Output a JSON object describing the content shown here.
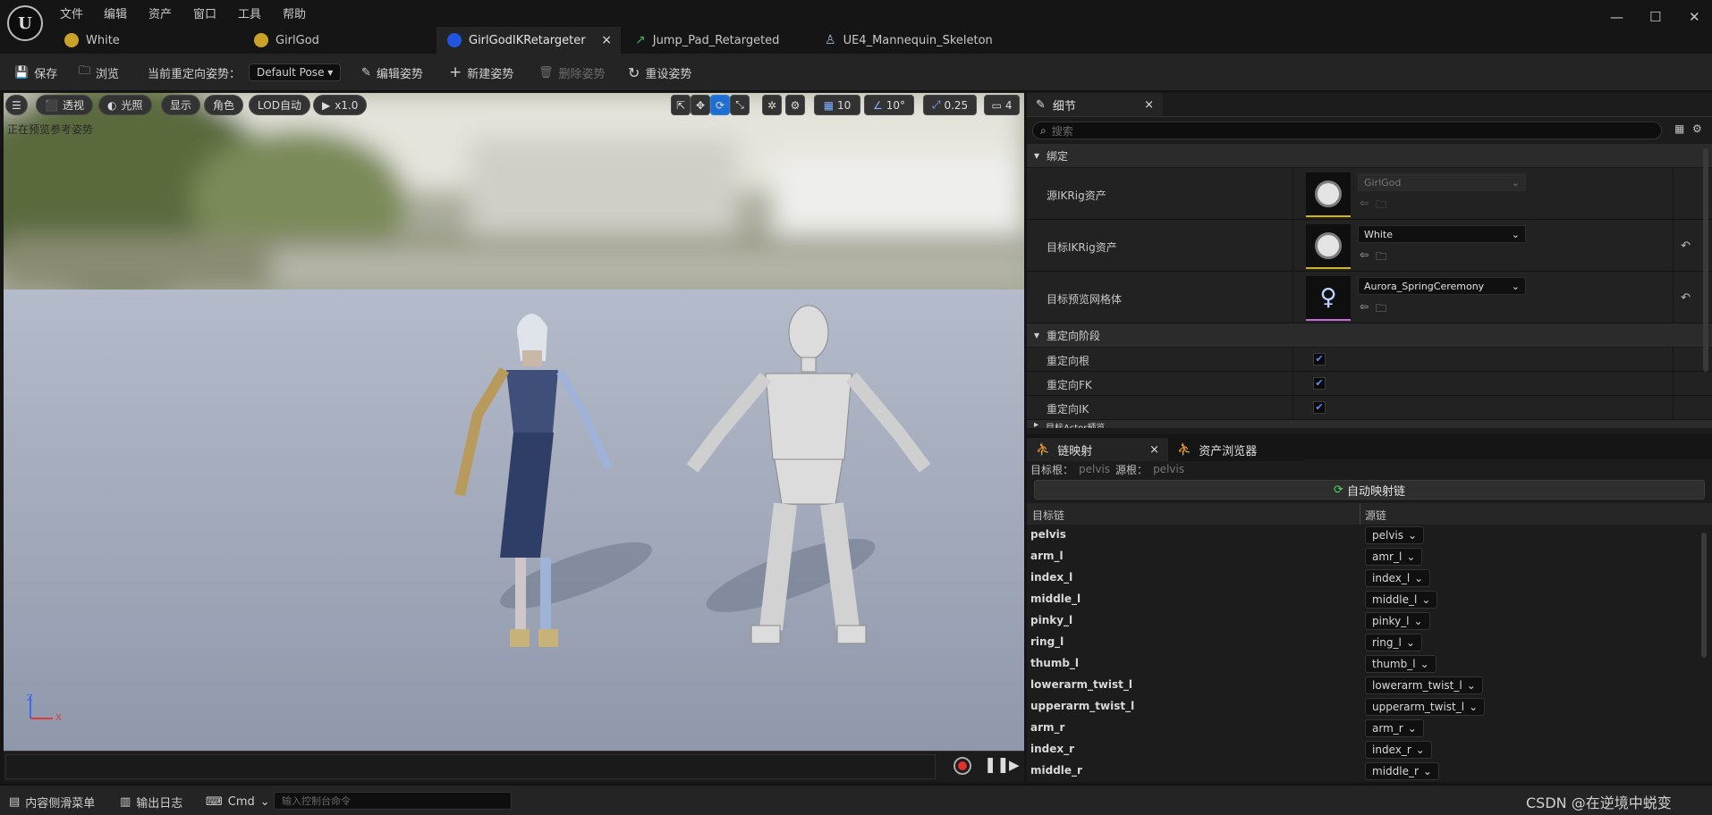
{
  "menu": [
    "文件",
    "编辑",
    "资产",
    "窗口",
    "工具",
    "帮助"
  ],
  "window_controls": {
    "minimize": "—",
    "maximize": "☐",
    "close": "✕"
  },
  "tabs": [
    {
      "label": "White",
      "icon_color": "#c9a227"
    },
    {
      "label": "GirlGod",
      "icon_color": "#c9a227"
    },
    {
      "label": "GirlGodIKRetargeter",
      "icon_color": "#2255dd",
      "close": "×"
    },
    {
      "label": "Jump_Pad_Retargeted",
      "icon_color": "#4caf50"
    },
    {
      "label": "UE4_Mannequin_Skeleton",
      "icon_color": "#9fb8d8"
    }
  ],
  "toolbar": {
    "save": "保存",
    "browse": "浏览",
    "current_pose_label": "当前重定向姿势：",
    "pose_value": "Default Pose",
    "edit_pose": "编辑姿势",
    "new_pose": "新建姿势",
    "delete_pose": "删除姿势",
    "reset_pose": "重设姿势"
  },
  "viewport": {
    "perspective": "透视",
    "lighting": "光照",
    "show": "显示",
    "character": "角色",
    "lod": "LOD自动",
    "speed": "x1.0",
    "status": "正在预览参考姿势",
    "grid": "10",
    "angle": "10°",
    "scale": "0.25",
    "camera": "4",
    "axis_x": "X",
    "axis_z": "Z"
  },
  "details": {
    "tab": "细节",
    "close": "×",
    "search_placeholder": "搜索",
    "section_binding": "绑定",
    "source_ikrig_label": "源IKRig资产",
    "source_ikrig_value": "GirlGod",
    "target_ikrig_label": "目标IKRig资产",
    "target_ikrig_value": "White",
    "target_mesh_label": "目标预览网格体",
    "target_mesh_value": "Aurora_SpringCeremony",
    "section_phases": "重定向阶段",
    "retarget_root": "重定向根",
    "retarget_fk": "重定向FK",
    "retarget_ik": "重定向IK",
    "partial_row": "目标Actor预览"
  },
  "chain_panel": {
    "tab": "链映射",
    "close": "×",
    "tab_asset_browser": "资产浏览器",
    "target_root_label": "目标根：",
    "target_root_value": "pelvis",
    "source_root_label": "源根：",
    "source_root_value": "pelvis",
    "auto_map": "自动映射链",
    "col_target": "目标链",
    "col_source": "源链",
    "rows": [
      {
        "target": "pelvis",
        "source": "pelvis"
      },
      {
        "target": "arm_l",
        "source": "amr_l"
      },
      {
        "target": "index_l",
        "source": "index_l"
      },
      {
        "target": "middle_l",
        "source": "middle_l"
      },
      {
        "target": "pinky_l",
        "source": "pinky_l"
      },
      {
        "target": "ring_l",
        "source": "ring_l"
      },
      {
        "target": "thumb_l",
        "source": "thumb_l"
      },
      {
        "target": "lowerarm_twist_l",
        "source": "lowerarm_twist_l"
      },
      {
        "target": "upperarm_twist_l",
        "source": "upperarm_twist_l"
      },
      {
        "target": "arm_r",
        "source": "arm_r"
      },
      {
        "target": "index_r",
        "source": "index_r"
      },
      {
        "target": "middle_r",
        "source": "middle_r"
      }
    ]
  },
  "bottom_bar": {
    "content_drawer": "内容侧滑菜单",
    "output_log": "输出日志",
    "cmd": "Cmd",
    "console_placeholder": "输入控制台命令",
    "watermark": "CSDN @在逆境中蜕变"
  }
}
